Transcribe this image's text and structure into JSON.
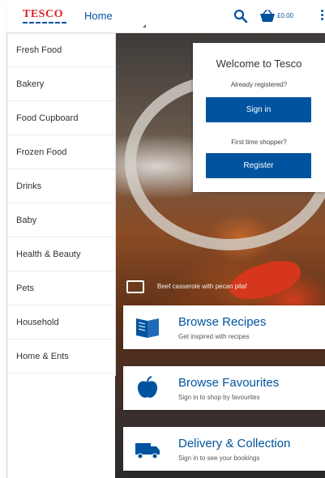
{
  "header": {
    "logo_text": "TESCO",
    "home_label": "Home",
    "basket_total": "£0.00",
    "icons": [
      "search-icon",
      "basket-icon",
      "more-vert-icon"
    ]
  },
  "sidebar": {
    "items": [
      {
        "label": "Fresh Food"
      },
      {
        "label": "Bakery"
      },
      {
        "label": "Food Cupboard"
      },
      {
        "label": "Frozen Food"
      },
      {
        "label": "Drinks"
      },
      {
        "label": "Baby"
      },
      {
        "label": "Health & Beauty"
      },
      {
        "label": "Pets"
      },
      {
        "label": "Household"
      },
      {
        "label": "Home & Ents"
      }
    ]
  },
  "hero": {
    "caption": "Beef casserole with pecan pilaf"
  },
  "welcome": {
    "title": "Welcome to Tesco",
    "registered_prompt": "Already registered?",
    "signin_label": "Sign in",
    "first_time_prompt": "First time shopper?",
    "register_label": "Register"
  },
  "cards": [
    {
      "title": "Browse Recipes",
      "subtitle": "Get inspired with recipes",
      "icon": "recipe-book-icon"
    },
    {
      "title": "Browse Favourites",
      "subtitle": "Sign in to shop by favourites",
      "icon": "apple-icon"
    },
    {
      "title": "Delivery & Collection",
      "subtitle": "Sign in to see your bookings",
      "icon": "delivery-van-icon"
    }
  ],
  "colors": {
    "brand_blue": "#00539f",
    "brand_red": "#d7262c"
  }
}
